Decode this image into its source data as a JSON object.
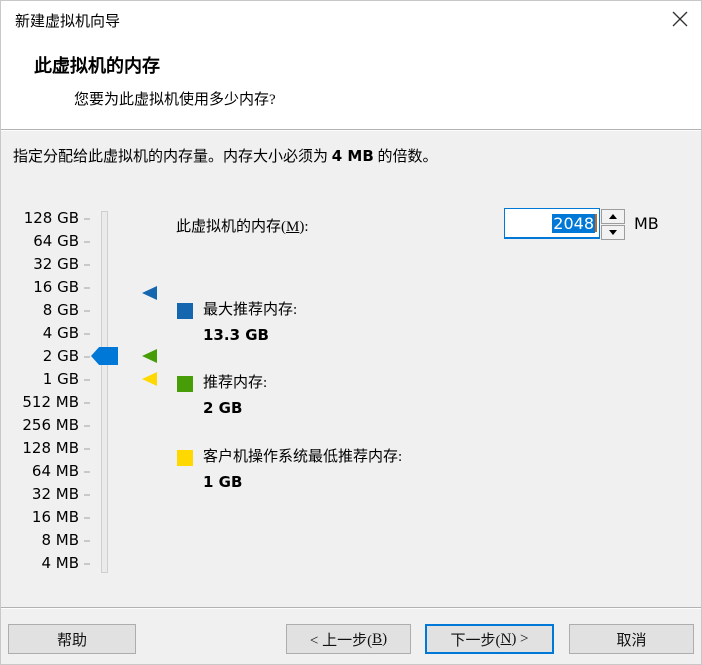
{
  "window": {
    "title": "新建虚拟机向导",
    "close_icon": "✕"
  },
  "header": {
    "title": "此虚拟机的内存",
    "subtitle": "您要为此虚拟机使用多少内存?"
  },
  "instruction": {
    "pre": "指定分配给此虚拟机的内存量。内存大小必须为 ",
    "strong": "4 MB",
    "post": " 的倍数。"
  },
  "scale": {
    "labels": [
      "128 GB",
      "64 GB",
      "32 GB",
      "16 GB",
      "8 GB",
      "4 GB",
      "2 GB",
      "1 GB",
      "512 MB",
      "256 MB",
      "128 MB",
      "64 MB",
      "32 MB",
      "16 MB",
      "8 MB",
      "4 MB"
    ]
  },
  "memory_field": {
    "label_pre": "此虚拟机的内存(",
    "access_key": "M",
    "label_post": "):",
    "value": "2048",
    "unit": "MB"
  },
  "slider": {
    "current_value": "2 GB",
    "handle_color": "#0078d7"
  },
  "legend": {
    "max": {
      "label": "最大推荐内存:",
      "value": "13.3 GB",
      "color": "#1467af"
    },
    "recommended": {
      "label": "推荐内存:",
      "value": "2 GB",
      "color": "#479d07"
    },
    "minimum": {
      "label": "客户机操作系统最低推荐内存:",
      "value": "1 GB",
      "color": "#ffd800"
    }
  },
  "buttons": {
    "help": "帮助",
    "back": {
      "pre": "< 上一步(",
      "key": "B",
      "post": ")"
    },
    "next": {
      "pre": "下一步(",
      "key": "N",
      "post": ") >"
    },
    "cancel": "取消"
  }
}
